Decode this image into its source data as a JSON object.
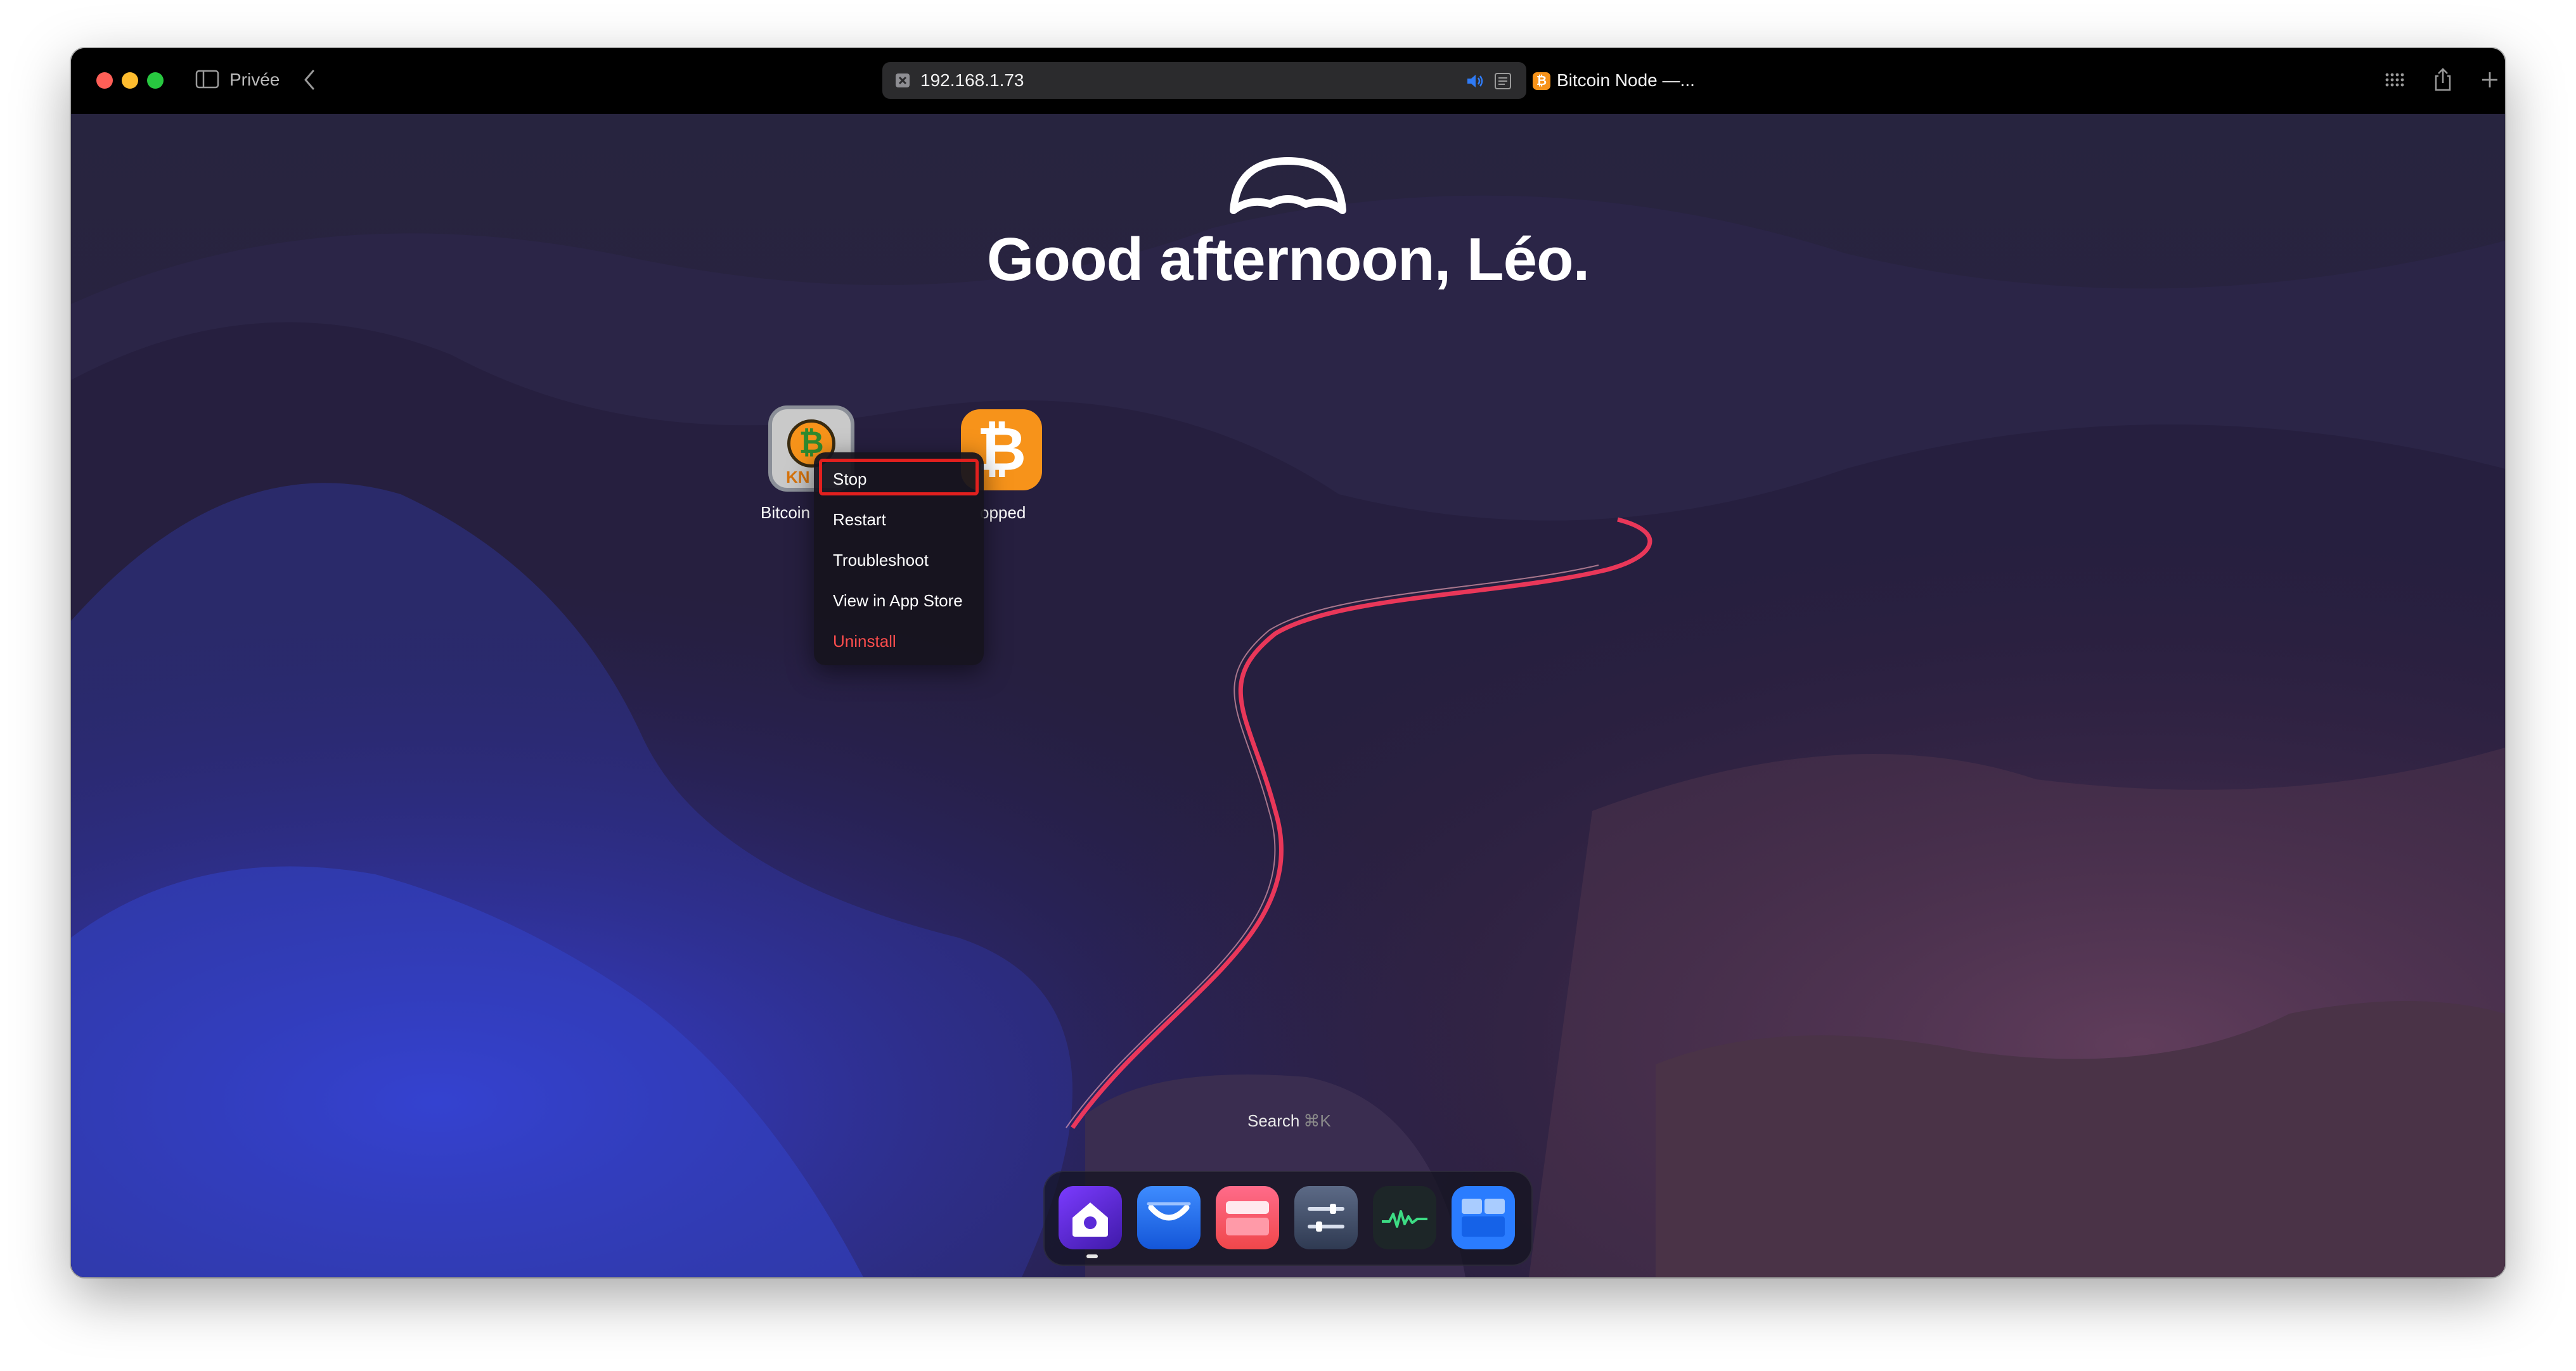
{
  "browser": {
    "mode_label": "Privée",
    "address": "192.168.1.73",
    "tab_title": "Bitcoin Node —..."
  },
  "home": {
    "greeting": "Good afternoon, Léo.",
    "search_label": "Search",
    "search_shortcut": "⌘K"
  },
  "apps": [
    {
      "label": "Bitcoin",
      "icon": "bitcoin-knots-icon",
      "tile_text": "KN"
    },
    {
      "label": "opped",
      "icon": "bitcoin-icon",
      "tile_text": "₿"
    }
  ],
  "context_menu": {
    "items": [
      {
        "label": "Stop",
        "highlighted": true
      },
      {
        "label": "Restart"
      },
      {
        "label": "Troubleshoot"
      },
      {
        "label": "View in App Store"
      },
      {
        "label": "Uninstall",
        "color": "#ff4d4d"
      }
    ]
  },
  "dock": {
    "items": [
      {
        "icon": "home-icon",
        "active": true
      },
      {
        "icon": "files-icon"
      },
      {
        "icon": "app-store-icon"
      },
      {
        "icon": "settings-icon"
      },
      {
        "icon": "live-usage-icon"
      },
      {
        "icon": "widgets-icon"
      }
    ]
  },
  "colors": {
    "accent_orange": "#f7931a",
    "destructive_red": "#ff4d4d",
    "highlight_border": "#e2201e"
  }
}
